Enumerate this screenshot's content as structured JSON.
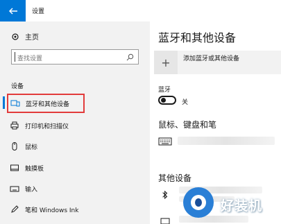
{
  "window": {
    "title": "设置"
  },
  "sidebar": {
    "home_label": "主页",
    "search_placeholder": "查找设置",
    "section_label": "设备",
    "items": [
      {
        "label": "蓝牙和其他设备",
        "icon": "bluetooth-devices-icon",
        "active": true
      },
      {
        "label": "打印机和扫描仪",
        "icon": "printer-icon"
      },
      {
        "label": "鼠标",
        "icon": "mouse-icon"
      },
      {
        "label": "触摸板",
        "icon": "touchpad-icon"
      },
      {
        "label": "输入",
        "icon": "keyboard-icon"
      },
      {
        "label": "笔和 Windows Ink",
        "icon": "pen-icon"
      }
    ]
  },
  "main": {
    "title": "蓝牙和其他设备",
    "add_device_label": "添加蓝牙或其他设备",
    "bluetooth_label": "蓝牙",
    "bluetooth_state": "关",
    "mouse_keyboard_section": "鼠标、键盘和笔",
    "other_devices_section": "其他设备"
  },
  "watermark": {
    "text": "好装机"
  },
  "colors": {
    "accent": "#0078d7",
    "highlight_border": "#e23b3b",
    "sidebar_bg": "#f2f2f2"
  }
}
